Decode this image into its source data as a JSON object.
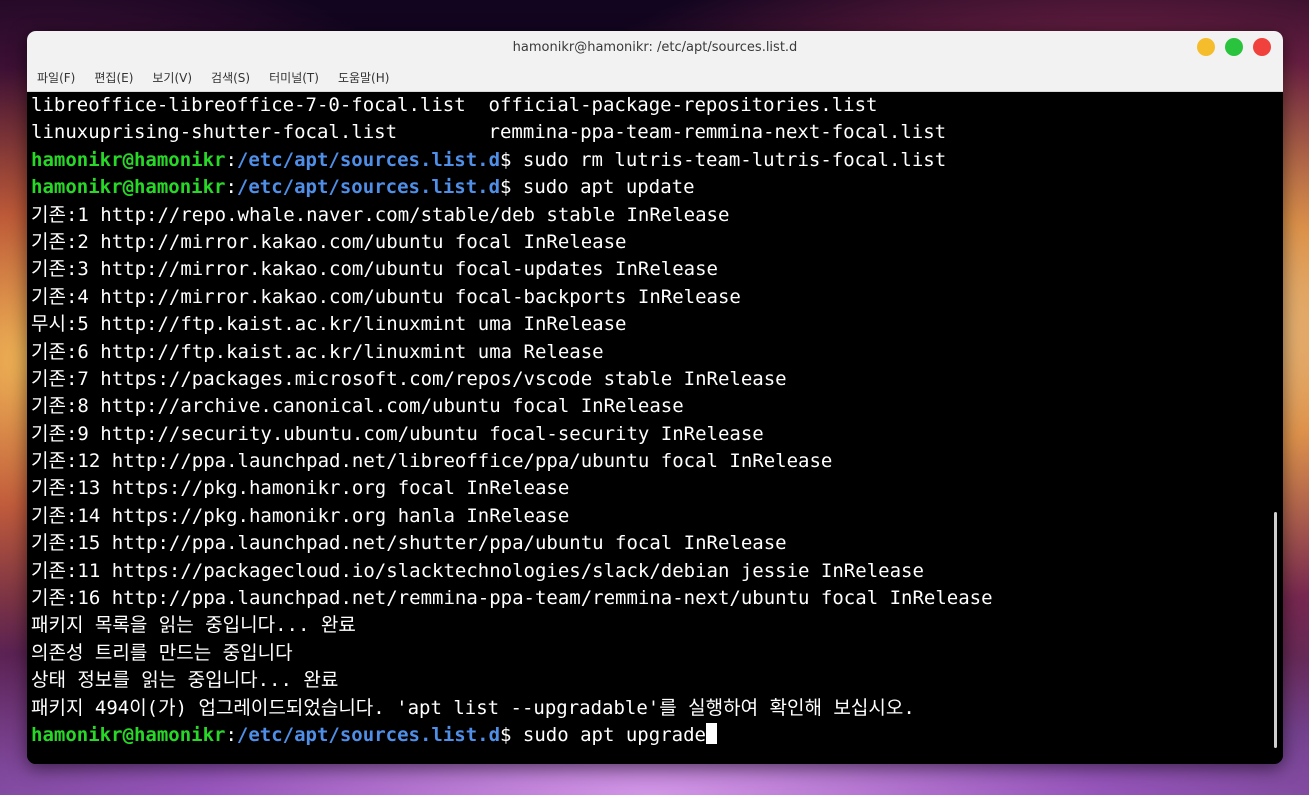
{
  "window": {
    "title": "hamonikr@hamonikr: /etc/apt/sources.list.d",
    "buttons": [
      {
        "name": "minimize",
        "color": "#f5bd2c"
      },
      {
        "name": "maximize",
        "color": "#2ac33e"
      },
      {
        "name": "close",
        "color": "#f0413d"
      }
    ]
  },
  "menu": [
    "파일(F)",
    "편집(E)",
    "보기(V)",
    "검색(S)",
    "터미널(T)",
    "도움말(H)"
  ],
  "prompt": {
    "user": "hamonikr@hamonikr",
    "sep": ":",
    "path": "/etc/apt/sources.list.d",
    "symbol": "$ "
  },
  "terminal": {
    "lines": [
      {
        "type": "out",
        "text": "libreoffice-libreoffice-7-0-focal.list  official-package-repositories.list"
      },
      {
        "type": "out",
        "text": "linuxuprising-shutter-focal.list        remmina-ppa-team-remmina-next-focal.list"
      },
      {
        "type": "cmd",
        "text": "sudo rm lutris-team-lutris-focal.list"
      },
      {
        "type": "cmd",
        "text": "sudo apt update"
      },
      {
        "type": "out",
        "text": "기존:1 http://repo.whale.naver.com/stable/deb stable InRelease"
      },
      {
        "type": "out",
        "text": "기존:2 http://mirror.kakao.com/ubuntu focal InRelease"
      },
      {
        "type": "out",
        "text": "기존:3 http://mirror.kakao.com/ubuntu focal-updates InRelease"
      },
      {
        "type": "out",
        "text": "기존:4 http://mirror.kakao.com/ubuntu focal-backports InRelease"
      },
      {
        "type": "out",
        "text": "무시:5 http://ftp.kaist.ac.kr/linuxmint uma InRelease"
      },
      {
        "type": "out",
        "text": "기존:6 http://ftp.kaist.ac.kr/linuxmint uma Release"
      },
      {
        "type": "out",
        "text": "기존:7 https://packages.microsoft.com/repos/vscode stable InRelease"
      },
      {
        "type": "out",
        "text": "기존:8 http://archive.canonical.com/ubuntu focal InRelease"
      },
      {
        "type": "out",
        "text": "기존:9 http://security.ubuntu.com/ubuntu focal-security InRelease"
      },
      {
        "type": "out",
        "text": "기존:12 http://ppa.launchpad.net/libreoffice/ppa/ubuntu focal InRelease"
      },
      {
        "type": "out",
        "text": "기존:13 https://pkg.hamonikr.org focal InRelease"
      },
      {
        "type": "out",
        "text": "기존:14 https://pkg.hamonikr.org hanla InRelease"
      },
      {
        "type": "out",
        "text": "기존:15 http://ppa.launchpad.net/shutter/ppa/ubuntu focal InRelease"
      },
      {
        "type": "out",
        "text": "기존:11 https://packagecloud.io/slacktechnologies/slack/debian jessie InRelease"
      },
      {
        "type": "out",
        "text": "기존:16 http://ppa.launchpad.net/remmina-ppa-team/remmina-next/ubuntu focal InRelease"
      },
      {
        "type": "out",
        "text": "패키지 목록을 읽는 중입니다... 완료"
      },
      {
        "type": "out",
        "text": "의존성 트리를 만드는 중입니다"
      },
      {
        "type": "out",
        "text": "상태 정보를 읽는 중입니다... 완료"
      },
      {
        "type": "out",
        "text": "패키지 494이(가) 업그레이드되었습니다. 'apt list --upgradable'를 실행하여 확인해 보십시오."
      },
      {
        "type": "cmd",
        "text": "sudo apt upgrade",
        "cursor": true
      }
    ]
  }
}
